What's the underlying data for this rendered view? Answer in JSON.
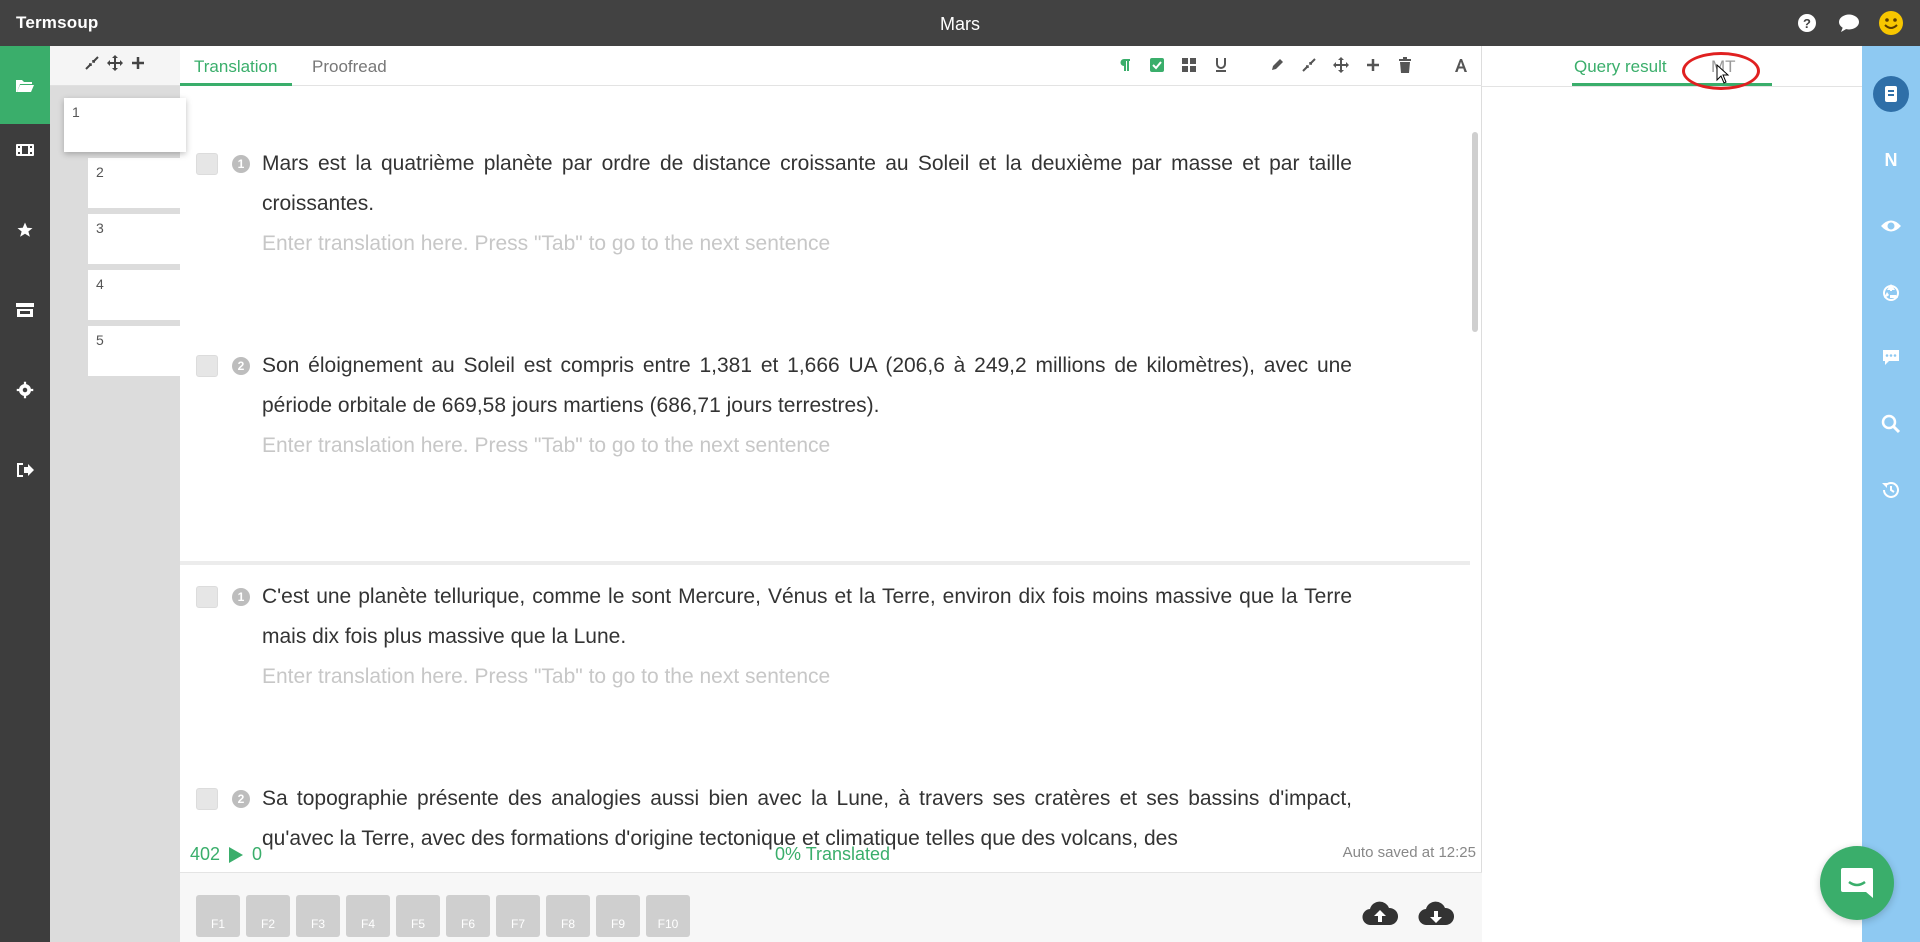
{
  "app": {
    "name": "Termsoup",
    "doc_title": "Mars"
  },
  "thumbnails": [
    "1",
    "2",
    "3",
    "4",
    "5"
  ],
  "tabs": {
    "translation": "Translation",
    "proofread": "Proofread"
  },
  "sentences": [
    {
      "number": "1",
      "text": "Mars est la quatrième planète par ordre de distance croissante au Soleil et la deuxième par masse et par taille croissantes.",
      "placeholder": "Enter translation here. Press \"Tab\" to go to the next sentence"
    },
    {
      "number": "2",
      "text": "Son éloignement au Soleil est compris entre 1,381 et 1,666 UA (206,6 à 249,2 millions de kilomètres), avec une période orbitale de 669,58 jours martiens (686,71 jours terrestres).",
      "placeholder": "Enter translation here. Press \"Tab\" to go to the next sentence"
    },
    {
      "number": "1",
      "text": "C'est une planète tellurique, comme le sont Mercure, Vénus et la Terre, environ dix fois moins massive que la Terre mais dix fois plus massive que la Lune.",
      "placeholder": "Enter translation here. Press \"Tab\" to go to the next sentence"
    },
    {
      "number": "2",
      "text": "Sa topographie présente des analogies aussi bien avec la Lune, à travers ses cratères et ses bassins d'impact, qu'avec la Terre, avec des formations d'origine tectonique et climatique telles que des volcans, des"
    }
  ],
  "status": {
    "word_count": "402",
    "played_count": "0",
    "translated": "0% Translated",
    "autosave": "Auto saved at 12:25"
  },
  "fkeys": [
    "F1",
    "F2",
    "F3",
    "F4",
    "F5",
    "F6",
    "F7",
    "F8",
    "F9",
    "F10"
  ],
  "right_panel": {
    "query_result": "Query result",
    "mt": "MT"
  },
  "right_bar": {
    "n_label": "N"
  },
  "colors": {
    "accent": "#3aae6b",
    "topbar": "#424242",
    "sidebar": "#3d3d3d",
    "rightbar": "#8ec9f2",
    "highlight": "#e02020"
  }
}
